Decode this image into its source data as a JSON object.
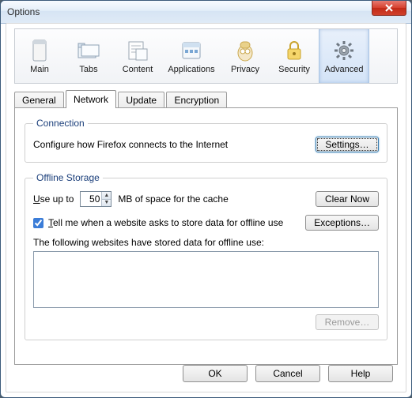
{
  "window": {
    "title": "Options"
  },
  "toolbar": {
    "items": [
      {
        "label": "Main"
      },
      {
        "label": "Tabs"
      },
      {
        "label": "Content"
      },
      {
        "label": "Applications"
      },
      {
        "label": "Privacy"
      },
      {
        "label": "Security"
      },
      {
        "label": "Advanced"
      }
    ],
    "selected_index": 6
  },
  "subtabs": {
    "items": [
      {
        "label": "General"
      },
      {
        "label": "Network"
      },
      {
        "label": "Update"
      },
      {
        "label": "Encryption"
      }
    ],
    "active_index": 1
  },
  "connection": {
    "legend": "Connection",
    "text": "Configure how Firefox connects to the Internet",
    "settings_button": "Settings…"
  },
  "offline": {
    "legend": "Offline Storage",
    "use_up_to_prefix": "Use up to",
    "cache_mb": "50",
    "use_up_to_suffix": "MB of space for the cache",
    "clear_now": "Clear Now",
    "tell_me_checked": true,
    "tell_me_label": "Tell me when a website asks to store data for offline use",
    "exceptions": "Exceptions…",
    "list_caption": "The following websites have stored data for offline use:",
    "remove": "Remove…"
  },
  "footer": {
    "ok": "OK",
    "cancel": "Cancel",
    "help": "Help"
  }
}
